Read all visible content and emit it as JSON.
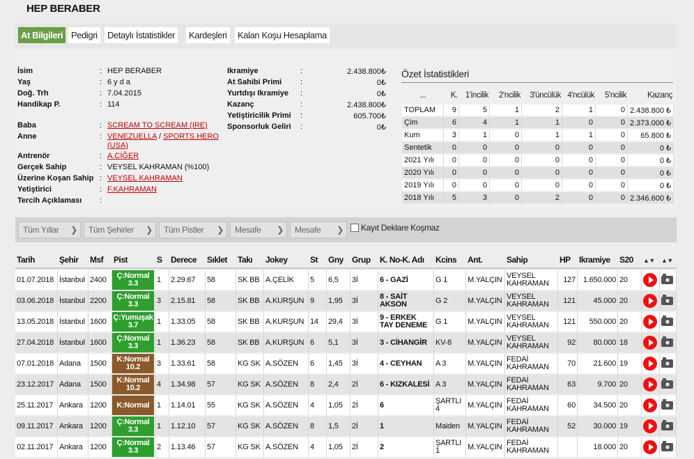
{
  "title": "HEP BERABER",
  "tabs": [
    "At Bilgileri",
    "Pedigri",
    "Detaylı İstatistikler",
    "Kardeşleri",
    "Kalan Koşu Hesaplama"
  ],
  "info": {
    "isim_label": "İsim",
    "isim": "HEP BERABER",
    "yas_label": "Yaş",
    "yas": "6 y d a",
    "dogtrh_label": "Doğ. Trh",
    "dogtrh": "7.04.2015",
    "handikap_label": "Handikap P.",
    "handikap": "114",
    "baba_label": "Baba",
    "baba": "SCREAM TO SCREAM (IRE)",
    "anne_label": "Anne",
    "anne": "VENEZUELLA",
    "anne_sep": "/",
    "anne_baba": "SPORTS HERO",
    "anne_baba_country": "(USA)",
    "antrenor_label": "Antrenör",
    "antrenor": "A.CİĞER",
    "gercek_sahip_label": "Gerçek Sahip",
    "gercek_sahip": "VEYSEL KAHRAMAN (%100)",
    "uzerine_label": "Üzerine Koşan Sahip",
    "uzerine": "VEYSEL KAHRAMAN",
    "yetistirici_label": "Yetiştirici",
    "yetistirici": "F.KAHRAMAN",
    "tercih_label": "Tercih Açıklaması",
    "tercih": ""
  },
  "money": {
    "ikramiye_label": "Ikramiye",
    "ikramiye": "2.438.800₺",
    "at_sahibi_label": "At Sahibi Primi",
    "at_sahibi": "0₺",
    "yurtdisi_label": "Yurtdışı Ikramiye",
    "yurtdisi": "0₺",
    "kazanc_label": "Kazanç",
    "kazanc": "2.438.800₺",
    "yetistiricilik_label": "Yetiştiricilik Primi",
    "yetistiricilik": "605.700₺",
    "sponsor_label": "Sponsorluk Geliri",
    "sponsor": "0₺"
  },
  "stats": {
    "title": "Özet İstatistikleri",
    "headers": [
      "...",
      "K.",
      "1'incilik",
      "2'ncilik",
      "3'üncülük",
      "4'ncülük",
      "5'ncilik",
      "Kazanç"
    ],
    "rows": [
      [
        "TOPLAM",
        "9",
        "5",
        "1",
        "2",
        "1",
        "0",
        "2.438.800 ₺"
      ],
      [
        "Çim",
        "6",
        "4",
        "1",
        "1",
        "0",
        "0",
        "2.373.000 ₺"
      ],
      [
        "Kum",
        "3",
        "1",
        "0",
        "1",
        "1",
        "0",
        "65.800 ₺"
      ],
      [
        "Sentetik",
        "0",
        "0",
        "0",
        "0",
        "0",
        "0",
        "0 ₺"
      ],
      [
        "2021 Yılı",
        "0",
        "0",
        "0",
        "0",
        "0",
        "0",
        "0 ₺"
      ],
      [
        "2020 Yılı",
        "0",
        "0",
        "0",
        "0",
        "0",
        "0",
        "0 ₺"
      ],
      [
        "2019 Yılı",
        "0",
        "0",
        "0",
        "0",
        "0",
        "0",
        "0 ₺"
      ],
      [
        "2018 Yılı",
        "5",
        "3",
        "0",
        "2",
        "0",
        "0",
        "2.346.600 ₺"
      ]
    ]
  },
  "filters": [
    "Tüm Yıllar",
    "Tüm Şehirler",
    "Tüm Pistler",
    "Mesafe",
    "Mesafe"
  ],
  "kayit_label": "Kayıt Deklare Koşmaz",
  "races": {
    "headers": [
      "Tarih",
      "Şehir",
      "Msf",
      "Pist",
      "S",
      "Derece",
      "Sıklet",
      "Takı",
      "Jokey",
      "St",
      "Gny",
      "Grup",
      "K. No-K. Adı",
      "Kcins",
      "Ant.",
      "Sahip",
      "HP",
      "Ikramiye",
      "S20",
      "",
      ""
    ],
    "rows": [
      {
        "tarih": "01.07.2018",
        "sehir": "İstanbul",
        "msf": "2400",
        "pist1": "Ç:Normal",
        "pist2": "3.3",
        "pist_color": "green",
        "s": "1",
        "derece": "2.29.67",
        "siklet": "58",
        "taki": "SK BB",
        "jokey": "A.ÇELİK",
        "st": "5",
        "gny": "6,5",
        "grup": "3İ",
        "kno": "6 - GAZİ",
        "kcins": "G 1",
        "ant": "M.YALÇIN",
        "sahip": "VEYSEL KAHRAMAN",
        "hp": "127",
        "ikr": "1.650.000",
        "s20": "20"
      },
      {
        "tarih": "03.06.2018",
        "sehir": "İstanbul",
        "msf": "2200",
        "pist1": "Ç:Normal",
        "pist2": "3.3",
        "pist_color": "green",
        "s": "3",
        "derece": "2.15.81",
        "siklet": "58",
        "taki": "SK BB",
        "jokey": "A.KURŞUN",
        "st": "9",
        "gny": "1,95",
        "grup": "3İ",
        "kno": "8 - SAİT AKSON",
        "kcins": "G 2",
        "ant": "M.YALÇIN",
        "sahip": "VEYSEL KAHRAMAN",
        "hp": "121",
        "ikr": "45.000",
        "s20": "20"
      },
      {
        "tarih": "13.05.2018",
        "sehir": "İstanbul",
        "msf": "1600",
        "pist1": "Ç:Yumuşak",
        "pist2": "3.7",
        "pist_color": "green",
        "s": "1",
        "derece": "1.33.05",
        "siklet": "58",
        "taki": "SK BB",
        "jokey": "A.KURŞUN",
        "st": "14",
        "gny": "29,4",
        "grup": "3İ",
        "kno": "9 - ERKEK TAY DENEME",
        "kcins": "G 1",
        "ant": "M.YALÇIN",
        "sahip": "VEYSEL KAHRAMAN",
        "hp": "121",
        "ikr": "550.000",
        "s20": "20"
      },
      {
        "tarih": "27.04.2018",
        "sehir": "İstanbul",
        "msf": "1600",
        "pist1": "Ç:Normal",
        "pist2": "3.3",
        "pist_color": "green",
        "s": "1",
        "derece": "1.36.23",
        "siklet": "58",
        "taki": "SK BB",
        "jokey": "A.KURŞUN",
        "st": "6",
        "gny": "5,1",
        "grup": "3İ",
        "kno": "3 - CİHANGİR",
        "kcins": "KV-8",
        "ant": "M.YALÇIN",
        "sahip": "VEYSEL KAHRAMAN",
        "hp": "92",
        "ikr": "80.000",
        "s20": "18"
      },
      {
        "tarih": "07.01.2018",
        "sehir": "Adana",
        "msf": "1500",
        "pist1": "K:Normal",
        "pist2": "10.2",
        "pist_color": "brown",
        "s": "3",
        "derece": "1.33.61",
        "siklet": "58",
        "taki": "KG SK",
        "jokey": "A.SÖZEN",
        "st": "6",
        "gny": "1,45",
        "grup": "3İ",
        "kno": "4 - CEYHAN",
        "kcins": "A 3",
        "ant": "M.YALÇIN",
        "sahip": "FEDAİ KAHRAMAN",
        "hp": "70",
        "ikr": "21.600",
        "s20": "19"
      },
      {
        "tarih": "23.12.2017",
        "sehir": "Adana",
        "msf": "1500",
        "pist1": "K:Normal",
        "pist2": "10.2",
        "pist_color": "brown",
        "s": "4",
        "derece": "1.34.98",
        "siklet": "57",
        "taki": "KG SK",
        "jokey": "A.SÖZEN",
        "st": "8",
        "gny": "2,4",
        "grup": "2İ",
        "kno": "6 - KIZKALESİ",
        "kcins": "A 3",
        "ant": "M.YALÇIN",
        "sahip": "FEDAİ KAHRAMAN",
        "hp": "63",
        "ikr": "9.700",
        "s20": "20"
      },
      {
        "tarih": "25.11.2017",
        "sehir": "Ankara",
        "msf": "1200",
        "pist1": "K:Normal",
        "pist2": "",
        "pist_color": "brown",
        "s": "1",
        "derece": "1.14.01",
        "siklet": "55",
        "taki": "KG SK",
        "jokey": "A.SÖZEN",
        "st": "4",
        "gny": "1,05",
        "grup": "2İ",
        "kno": "6",
        "kcins": "ŞARTLI 4",
        "ant": "M.YALÇIN",
        "sahip": "FEDAİ KAHRAMAN",
        "hp": "60",
        "ikr": "34.500",
        "s20": "20"
      },
      {
        "tarih": "09.11.2017",
        "sehir": "Ankara",
        "msf": "1200",
        "pist1": "Ç:Normal",
        "pist2": "3.3",
        "pist_color": "green",
        "s": "1",
        "derece": "1.12.10",
        "siklet": "57",
        "taki": "KG SK",
        "jokey": "A.SÖZEN",
        "st": "8",
        "gny": "1,5",
        "grup": "2İ",
        "kno": "1",
        "kcins": "Maiden",
        "ant": "M.YALÇIN",
        "sahip": "FEDAİ KAHRAMAN",
        "hp": "52",
        "ikr": "30.000",
        "s20": "19"
      },
      {
        "tarih": "02.11.2017",
        "sehir": "Ankara",
        "msf": "1200",
        "pist1": "Ç:Normal",
        "pist2": "3.3",
        "pist_color": "green",
        "s": "2",
        "derece": "1.13.46",
        "siklet": "57",
        "taki": "KG SK",
        "jokey": "A.SÖZEN",
        "st": "4",
        "gny": "1,05",
        "grup": "2İ",
        "kno": "2",
        "kcins": "ŞARTLI 1",
        "ant": "M.YALÇIN",
        "sahip": "FEDAİ KAHRAMAN",
        "hp": "",
        "ikr": "18.000",
        "s20": "20"
      }
    ]
  }
}
